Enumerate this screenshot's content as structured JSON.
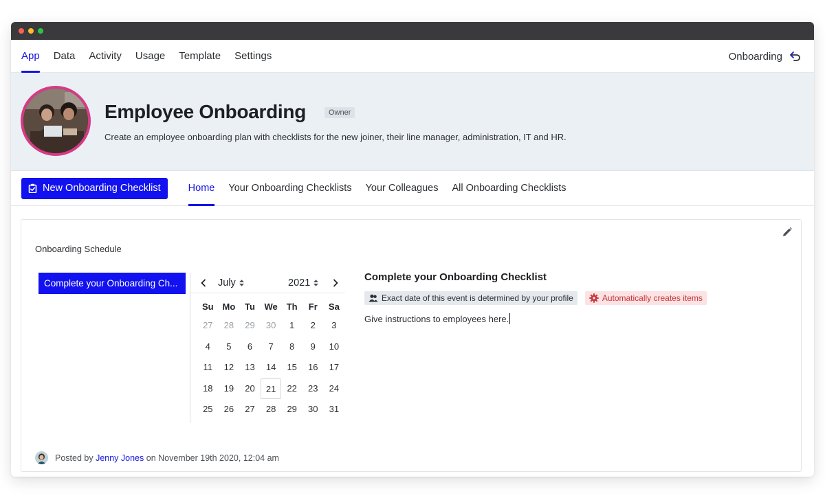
{
  "window": {
    "traffic_lights": [
      "#ff5f57",
      "#febc2e",
      "#28c840"
    ]
  },
  "topnav": {
    "tabs": [
      {
        "label": "App",
        "active": true
      },
      {
        "label": "Data",
        "active": false
      },
      {
        "label": "Activity",
        "active": false
      },
      {
        "label": "Usage",
        "active": false
      },
      {
        "label": "Template",
        "active": false
      },
      {
        "label": "Settings",
        "active": false
      }
    ],
    "right_label": "Onboarding",
    "right_icon": "back-arrow-icon"
  },
  "hero": {
    "title": "Employee Onboarding",
    "badge": "Owner",
    "description": "Create an employee onboarding plan with checklists for the new joiner, their line manager, administration, IT and HR.",
    "ring_color": "#d63a86"
  },
  "subnav": {
    "new_button_label": "New Onboarding Checklist",
    "new_button_icon": "clipboard-check-icon",
    "tabs": [
      {
        "label": "Home",
        "active": true
      },
      {
        "label": "Your Onboarding Checklists",
        "active": false
      },
      {
        "label": "Your Colleagues",
        "active": false
      },
      {
        "label": "All Onboarding Checklists",
        "active": false
      }
    ]
  },
  "schedule": {
    "title": "Onboarding Schedule",
    "event_chip": "Complete your Onboarding Ch...",
    "calendar": {
      "month": "July",
      "year": "2021",
      "weekdays": [
        "Su",
        "Mo",
        "Tu",
        "We",
        "Th",
        "Fr",
        "Sa"
      ],
      "days": [
        {
          "d": "27",
          "out": true
        },
        {
          "d": "28",
          "out": true
        },
        {
          "d": "29",
          "out": true
        },
        {
          "d": "30",
          "out": true
        },
        {
          "d": "1"
        },
        {
          "d": "2"
        },
        {
          "d": "3"
        },
        {
          "d": "4"
        },
        {
          "d": "5"
        },
        {
          "d": "6"
        },
        {
          "d": "7"
        },
        {
          "d": "8"
        },
        {
          "d": "9"
        },
        {
          "d": "10"
        },
        {
          "d": "11"
        },
        {
          "d": "12"
        },
        {
          "d": "13"
        },
        {
          "d": "14"
        },
        {
          "d": "15"
        },
        {
          "d": "16"
        },
        {
          "d": "17"
        },
        {
          "d": "18"
        },
        {
          "d": "19"
        },
        {
          "d": "20"
        },
        {
          "d": "21",
          "today": true
        },
        {
          "d": "22"
        },
        {
          "d": "23"
        },
        {
          "d": "24"
        },
        {
          "d": "25"
        },
        {
          "d": "26"
        },
        {
          "d": "27"
        },
        {
          "d": "28"
        },
        {
          "d": "29"
        },
        {
          "d": "30"
        },
        {
          "d": "31"
        }
      ]
    },
    "detail": {
      "title": "Complete your Onboarding Checklist",
      "tag_profile": "Exact date of this event is determined by your profile",
      "tag_auto": "Automatically creates items",
      "text": "Give instructions to employees here."
    }
  },
  "footer": {
    "posted_prefix": "Posted by",
    "author": "Jenny Jones",
    "posted_suffix": "on November 19th 2020, 12:04 am"
  },
  "colors": {
    "accent": "#1515e6",
    "button_blue": "#1212f0",
    "hero_bg": "#ebf0f5",
    "tag_red_text": "#c8333a",
    "tag_red_bg": "#fbe3e4"
  }
}
